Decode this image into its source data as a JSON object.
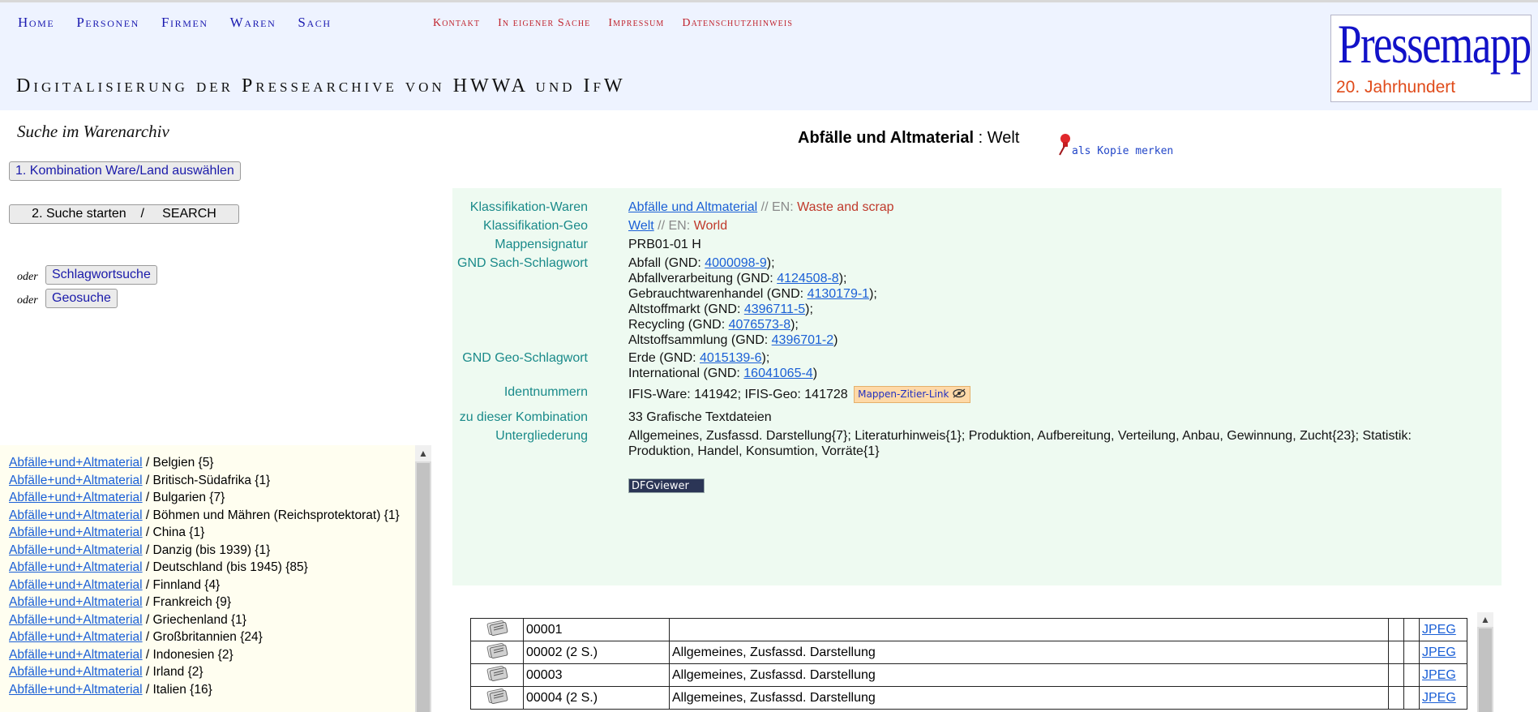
{
  "nav": {
    "main": [
      "Home",
      "Personen",
      "Firmen",
      "Waren",
      "Sach"
    ],
    "secondary": [
      "Kontakt",
      "In eigener Sache",
      "Impressum",
      "Datenschutzhinweis"
    ]
  },
  "site_title": "Digitalisierung der Pressearchive von HWWA und IfW",
  "logo": {
    "line1": "Pressemappe",
    "line2": "20. Jahrhundert"
  },
  "sidebar": {
    "heading": "Suche im Warenarchiv",
    "step1_button": "1. Kombination Ware/Land auswählen",
    "step2_button": "2. Suche starten    /     SEARCH",
    "oder": "oder",
    "keyword_button": "Schlagwortsuche",
    "geo_button": "Geosuche"
  },
  "combo_list": [
    {
      "link": "Abfälle+und+Altmaterial",
      "rest": " / Belgien {5}"
    },
    {
      "link": "Abfälle+und+Altmaterial",
      "rest": " / Britisch-Südafrika {1}"
    },
    {
      "link": "Abfälle+und+Altmaterial",
      "rest": " / Bulgarien {7}"
    },
    {
      "link": "Abfälle+und+Altmaterial",
      "rest": " / Böhmen und Mähren (Reichsprotektorat) {1}"
    },
    {
      "link": "Abfälle+und+Altmaterial",
      "rest": " / China {1}"
    },
    {
      "link": "Abfälle+und+Altmaterial",
      "rest": " / Danzig (bis 1939) {1}"
    },
    {
      "link": "Abfälle+und+Altmaterial",
      "rest": " / Deutschland (bis 1945) {85}"
    },
    {
      "link": "Abfälle+und+Altmaterial",
      "rest": " / Finnland {4}"
    },
    {
      "link": "Abfälle+und+Altmaterial",
      "rest": " / Frankreich {9}"
    },
    {
      "link": "Abfälle+und+Altmaterial",
      "rest": " / Griechenland {1}"
    },
    {
      "link": "Abfälle+und+Altmaterial",
      "rest": " / Großbritannien {24}"
    },
    {
      "link": "Abfälle+und+Altmaterial",
      "rest": " / Indonesien {2}"
    },
    {
      "link": "Abfälle+und+Altmaterial",
      "rest": " / Irland {2}"
    },
    {
      "link": "Abfälle+und+Altmaterial",
      "rest": " / Italien {16}"
    }
  ],
  "page_heading": {
    "ware": "Abfälle und Altmaterial",
    "sep": " : ",
    "geo": "Welt"
  },
  "copy_label": "als Kopie merken",
  "info": {
    "ware_label": "Klassifikation-Waren",
    "ware_link": "Abfälle und Altmaterial",
    "ware_en_prefix": " // EN: ",
    "ware_en": "Waste and scrap",
    "geo_label": "Klassifikation-Geo",
    "geo_link": "Welt",
    "geo_en_prefix": " // EN: ",
    "geo_en": "World",
    "sig_label": "Mappensignatur",
    "sig_value": "PRB01-01 H",
    "gnd_sach_label": "GND Sach-Schlagwort",
    "gnd_sach": [
      {
        "pre": "Abfall (GND: ",
        "id": "4000098-9",
        "post": ");"
      },
      {
        "pre": "Abfallverarbeitung (GND: ",
        "id": "4124508-8",
        "post": ");"
      },
      {
        "pre": "Gebrauchtwarenhandel (GND: ",
        "id": "4130179-1",
        "post": ");"
      },
      {
        "pre": "Altstoffmarkt (GND: ",
        "id": "4396711-5",
        "post": ");"
      },
      {
        "pre": "Recycling (GND: ",
        "id": "4076573-8",
        "post": ");"
      },
      {
        "pre": "Altstoffsammlung (GND: ",
        "id": "4396701-2",
        "post": ")"
      }
    ],
    "gnd_geo_label": "GND Geo-Schlagwort",
    "gnd_geo": [
      {
        "pre": "Erde (GND: ",
        "id": "4015139-6",
        "post": ");"
      },
      {
        "pre": "International (GND: ",
        "id": "16041065-4",
        "post": ")"
      }
    ],
    "ids_label": "Identnummern",
    "ids_value": "IFIS-Ware: 141942; IFIS-Geo: 141728",
    "cite_badge": "Mappen-Zitier-Link",
    "combo_label": "zu dieser Kombination",
    "combo_value": "33 Grafische Textdateien",
    "sub_label": "Untergliederung",
    "sub_value": "Allgemeines, Zusfassd. Darstellung{7}; Literaturhinweis{1}; Produktion, Aufbereitung, Verteilung, Anbau, Gewinnung, Zucht{23}; Statistik: Produktion, Handel, Konsumtion, Vorräte{1}",
    "dfg_label": "DFGviewer"
  },
  "files": [
    {
      "id": "00001",
      "desc": "",
      "link": "JPEG"
    },
    {
      "id": "00002 (2 S.)",
      "desc": "Allgemeines, Zusfassd. Darstellung",
      "link": "JPEG"
    },
    {
      "id": "00003",
      "desc": "Allgemeines, Zusfassd. Darstellung",
      "link": "JPEG"
    },
    {
      "id": "00004 (2 S.)",
      "desc": "Allgemeines, Zusfassd. Darstellung",
      "link": "JPEG"
    }
  ],
  "icons": [
    "pushpin-icon",
    "eye-slash-icon",
    "file-icon",
    "scroll-up-arrow-icon"
  ]
}
